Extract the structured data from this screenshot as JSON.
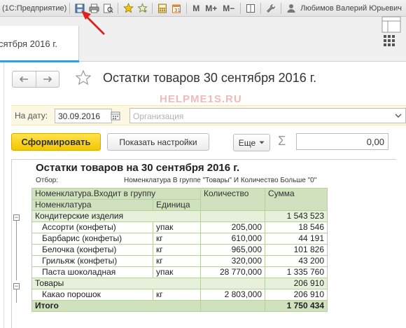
{
  "window": {
    "title": "(1С:Предприятие)",
    "user": "Любимов Валерий Юрьевич"
  },
  "toolbar": {
    "m_label": "M",
    "mplus_label": "M+",
    "mminus_label": "M−"
  },
  "tab": {
    "label": "сятбря 2016 г."
  },
  "form": {
    "title": "Остатки товаров 30 сентября 2016 г.",
    "date_label": "На дату:",
    "date_value": "30.09.2016",
    "org_placeholder": "Организация",
    "generate_button": "Сформировать",
    "settings_button": "Показать настройки",
    "more_button": "Еще",
    "sum_value": "0,00"
  },
  "report": {
    "title": "Остатки товаров на 30 сентября 2016 г.",
    "watermark": "HELPME1S.RU",
    "selection_label": "Отбор:",
    "selection_value": "Номенклатура В группе \"Товары\" И Количество Больше \"0\"",
    "header": {
      "group_col": "Номенклатура.Входит в группу",
      "item_col": "Номенклатура",
      "unit_col": "Единица",
      "qty_col": "Количество",
      "sum_col": "Сумма"
    },
    "groups": [
      {
        "name": "Кондитерские изделия",
        "sum": "1 543 523",
        "items": [
          {
            "name": "Ассорти (конфеты)",
            "unit": "упак",
            "qty": "205,000",
            "sum": "18 546"
          },
          {
            "name": "Барбарис (конфеты)",
            "unit": "кг",
            "qty": "610,000",
            "sum": "44 191"
          },
          {
            "name": "Белочка (конфеты)",
            "unit": "кг",
            "qty": "965,000",
            "sum": "101 826"
          },
          {
            "name": "Грильяж (конфеты)",
            "unit": "кг",
            "qty": "320,000",
            "sum": "43 200"
          },
          {
            "name": "Паста шоколадная",
            "unit": "упак",
            "qty": "28 770,000",
            "sum": "1 335 760"
          }
        ]
      },
      {
        "name": "Товары",
        "sum": "206 910",
        "items": [
          {
            "name": "Какао порошок",
            "unit": "кг",
            "qty": "2 803,000",
            "sum": "206 910"
          }
        ]
      }
    ],
    "total_label": "Итого",
    "total_sum": "1 750 434"
  },
  "colors": {
    "accent_blue": "#3c9bd8",
    "primary_button": "#f3c600",
    "table_header": "#cfe1bd",
    "annotation_arrow": "#e0201c"
  }
}
